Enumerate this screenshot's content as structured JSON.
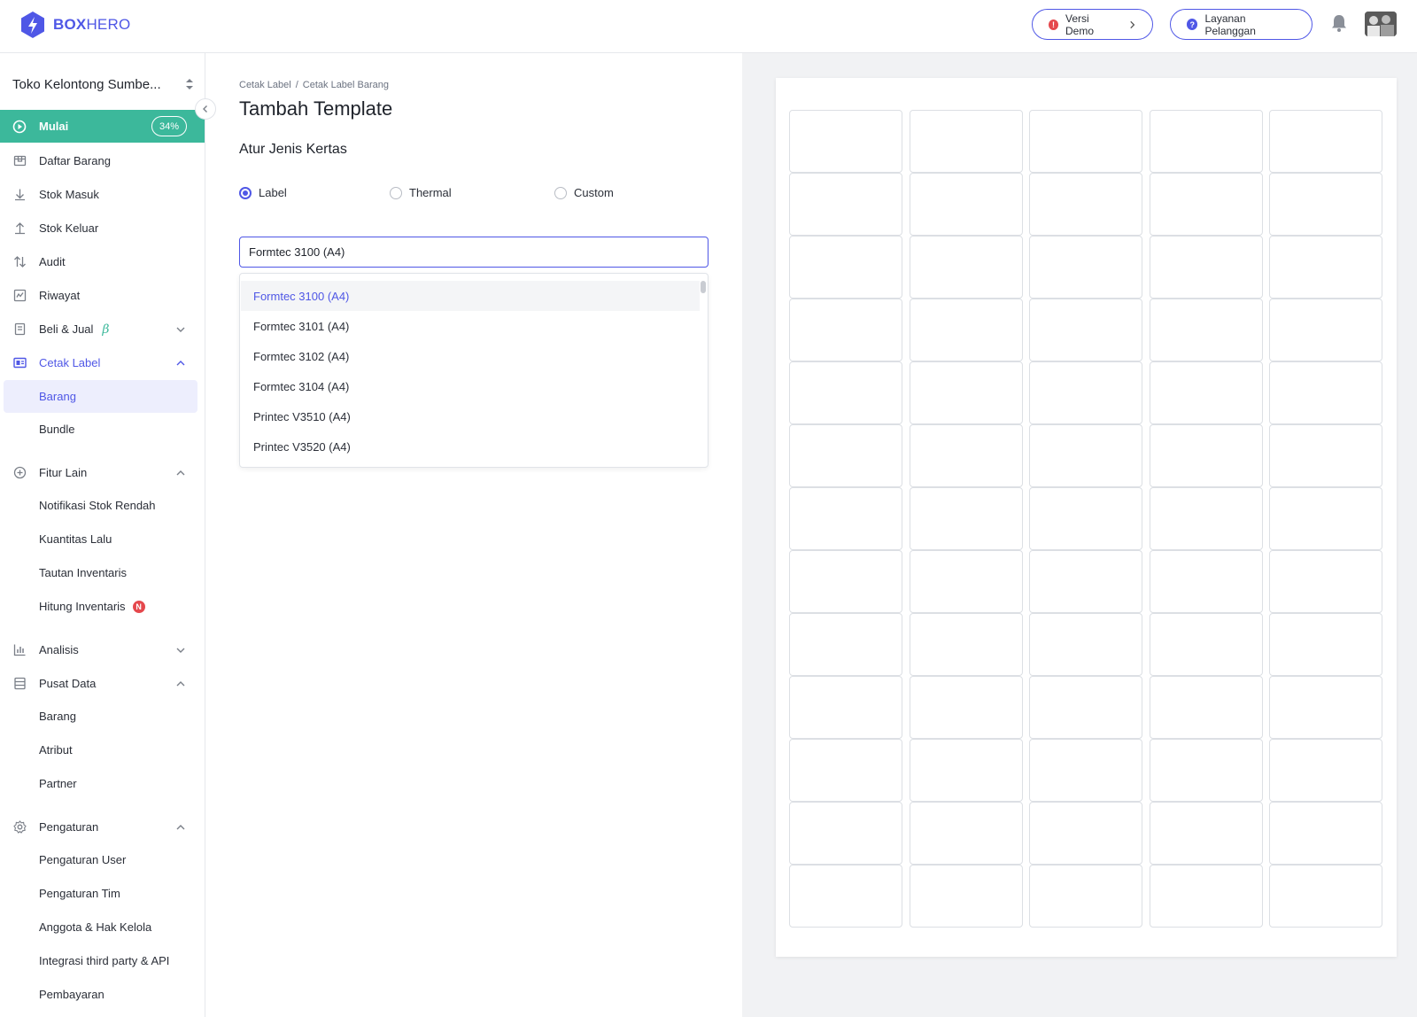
{
  "brand": {
    "bold": "BOX",
    "light": "HERO",
    "accent": "#4f57e6"
  },
  "header": {
    "demo_label": "Versi Demo",
    "support_label": "Layanan Pelanggan",
    "icons": [
      "alert-icon",
      "help-icon",
      "bell-icon",
      "avatar"
    ]
  },
  "sidebar": {
    "store_name": "Toko Kelontong Sumbe...",
    "start": {
      "label": "Mulai",
      "progress": "34%"
    },
    "items": [
      {
        "label": "Daftar Barang",
        "icon": "box-icon"
      },
      {
        "label": "Stok Masuk",
        "icon": "arrow-down-icon"
      },
      {
        "label": "Stok Keluar",
        "icon": "arrow-up-icon"
      },
      {
        "label": "Audit",
        "icon": "swap-icon"
      },
      {
        "label": "Riwayat",
        "icon": "history-icon"
      },
      {
        "label": "Beli & Jual",
        "icon": "receipt-icon",
        "beta": "β"
      },
      {
        "label": "Cetak Label",
        "icon": "label-icon"
      }
    ],
    "cetak_label_sub": [
      "Barang",
      "Bundle"
    ],
    "fitur_lain": {
      "label": "Fitur Lain",
      "sub": [
        "Notifikasi Stok Rendah",
        "Kuantitas Lalu",
        "Tautan Inventaris",
        "Hitung Inventaris"
      ],
      "new_badge": "N"
    },
    "analisis": "Analisis",
    "pusat_data": {
      "label": "Pusat Data",
      "sub": [
        "Barang",
        "Atribut",
        "Partner"
      ]
    },
    "pengaturan": {
      "label": "Pengaturan",
      "sub": [
        "Pengaturan User",
        "Pengaturan Tim",
        "Anggota & Hak Kelola",
        "Integrasi third party & API",
        "Pembayaran"
      ]
    },
    "active_color": "#3cb89b"
  },
  "main": {
    "breadcrumb": [
      "Cetak Label",
      "/",
      "Cetak Label Barang"
    ],
    "title": "Tambah Template",
    "section": "Atur Jenis Kertas",
    "paper_types": [
      {
        "label": "Label",
        "selected": true
      },
      {
        "label": "Thermal",
        "selected": false
      },
      {
        "label": "Custom",
        "selected": false
      }
    ],
    "select_value": "Formtec 3100 (A4)",
    "options": [
      "Formtec 3100 (A4)",
      "Formtec 3101 (A4)",
      "Formtec 3102 (A4)",
      "Formtec 3104 (A4)",
      "Printec V3510 (A4)",
      "Printec V3520 (A4)"
    ]
  },
  "preview": {
    "columns": 5,
    "rows": 13
  }
}
